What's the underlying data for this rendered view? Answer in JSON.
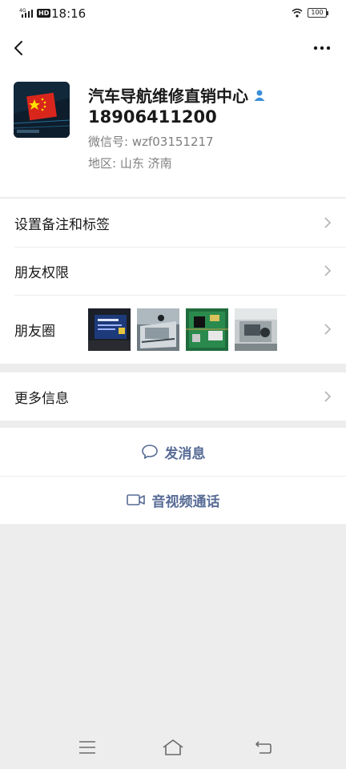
{
  "status_bar": {
    "network": "4G",
    "hd": "HD",
    "time": "18:16",
    "battery": "100"
  },
  "profile": {
    "name": "汽车导航维修直销中心",
    "phone": "18906411200",
    "wechat_id": "微信号: wzf03151217",
    "region": "地区: 山东  济南"
  },
  "menu": {
    "remark_tags": "设置备注和标签",
    "friend_permissions": "朋友权限",
    "moments": "朋友圈",
    "more_info": "更多信息"
  },
  "actions": {
    "send_message": "发消息",
    "video_call": "音视频通话"
  },
  "colors": {
    "accent": "#576b95",
    "background": "#ededed",
    "card": "#ffffff"
  }
}
